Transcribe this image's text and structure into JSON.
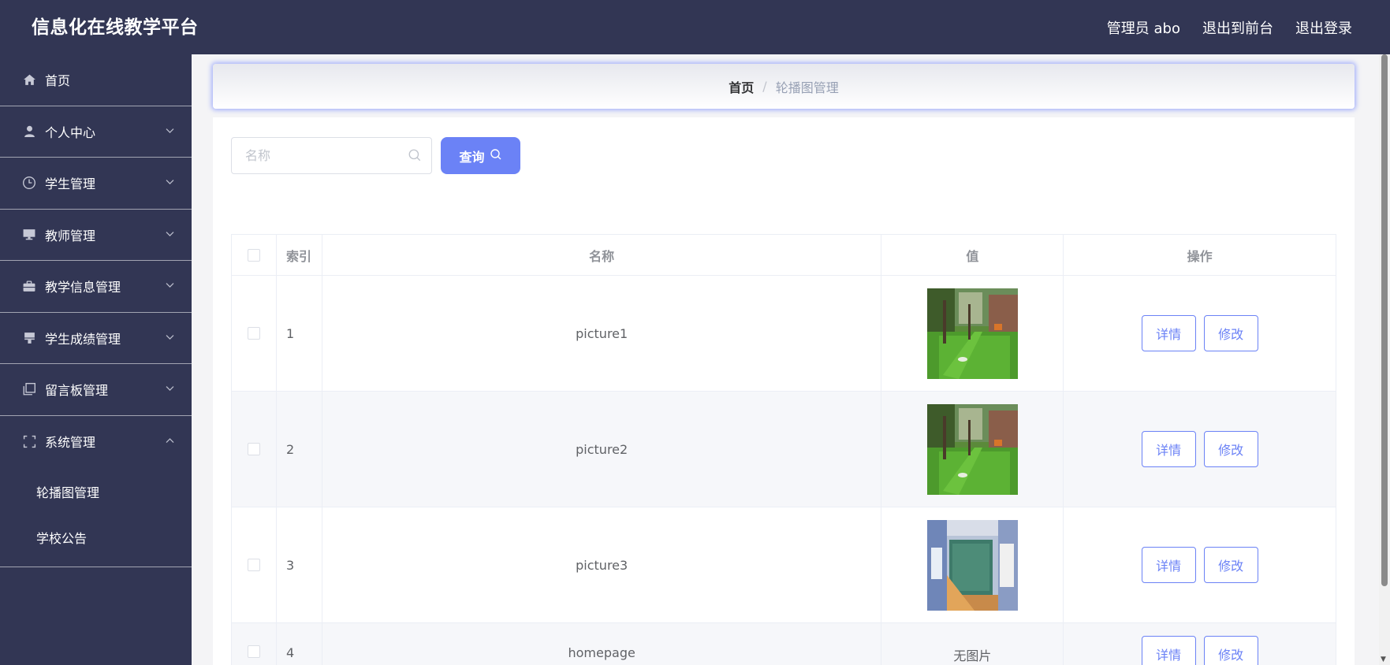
{
  "header": {
    "title": "信息化在线教学平台",
    "admin_label": "管理员 abo",
    "to_front": "退出到前台",
    "logout": "退出登录"
  },
  "sidebar": {
    "items": [
      {
        "label": "首页",
        "icon": "home-icon"
      },
      {
        "label": "个人中心",
        "icon": "user-icon"
      },
      {
        "label": "学生管理",
        "icon": "clock-icon"
      },
      {
        "label": "教师管理",
        "icon": "monitor-icon"
      },
      {
        "label": "教学信息管理",
        "icon": "briefcase-icon"
      },
      {
        "label": "学生成绩管理",
        "icon": "stamp-icon"
      },
      {
        "label": "留言板管理",
        "icon": "copy-icon"
      },
      {
        "label": "系统管理",
        "icon": "fullscreen-icon"
      }
    ],
    "submenu": [
      {
        "label": "轮播图管理"
      },
      {
        "label": "学校公告"
      }
    ]
  },
  "breadcrumb": {
    "home": "首页",
    "separator": "/",
    "current": "轮播图管理"
  },
  "search": {
    "placeholder": "名称",
    "query_button": "查询"
  },
  "table": {
    "headers": {
      "index": "索引",
      "name": "名称",
      "value": "值",
      "actions": "操作"
    },
    "rows": [
      {
        "index": "1",
        "name": "picture1",
        "value": "image"
      },
      {
        "index": "2",
        "name": "picture2",
        "value": "image"
      },
      {
        "index": "3",
        "name": "picture3",
        "value": "image"
      },
      {
        "index": "4",
        "name": "homepage",
        "value": "无图片"
      }
    ],
    "detail_label": "详情",
    "edit_label": "修改"
  },
  "colors": {
    "sidebar_bg": "#323654",
    "accent": "#6b82f6"
  }
}
